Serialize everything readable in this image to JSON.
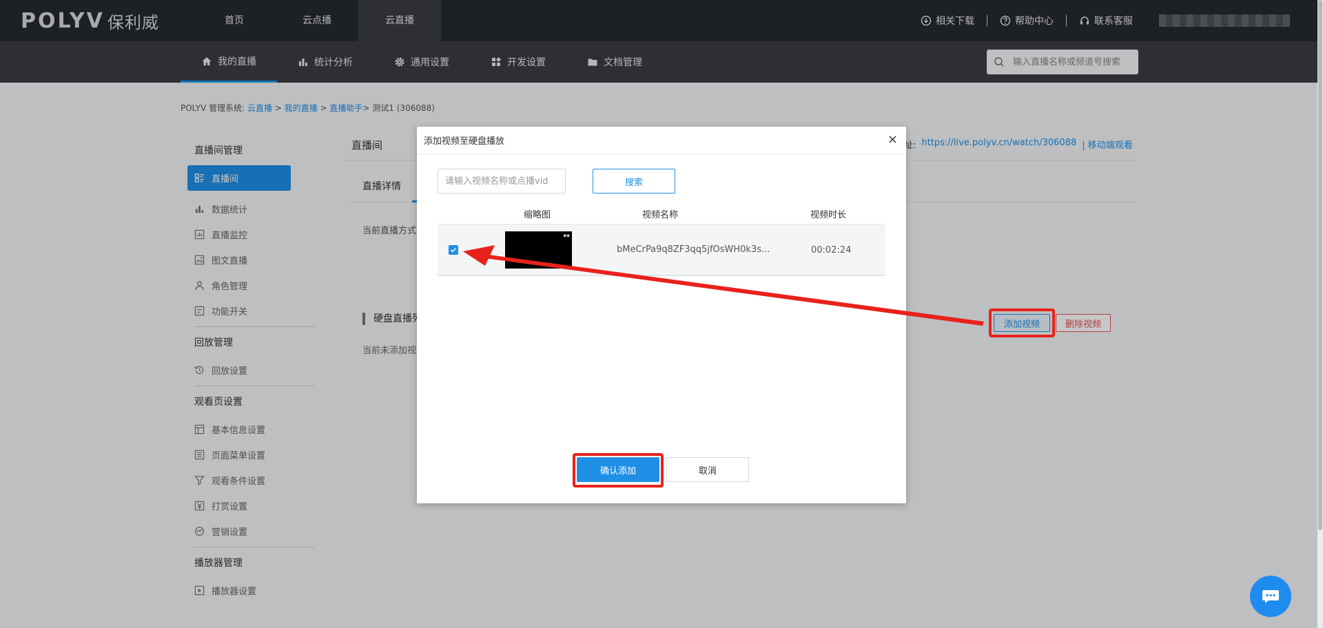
{
  "header": {
    "logo_en": "POLYV",
    "logo_cn": "保利威",
    "nav": [
      "首页",
      "云点播",
      "云直播"
    ],
    "right_links": [
      "相关下载",
      "帮助中心",
      "联系客服"
    ]
  },
  "subnav": {
    "items": [
      "我的直播",
      "统计分析",
      "通用设置",
      "开发设置",
      "文档管理"
    ],
    "search_placeholder": "输入直播名称或频道号搜索"
  },
  "breadcrumb": {
    "prefix": "POLYV 管理系统:",
    "items": [
      "云直播",
      "我的直播",
      "直播助手"
    ],
    "current": "测试1 (306088)"
  },
  "sidebar": {
    "groups": [
      {
        "title": "直播间管理",
        "items": [
          "直播间",
          "数据统计",
          "直播监控",
          "图文直播",
          "角色管理",
          "功能开关"
        ]
      },
      {
        "title": "回放管理",
        "items": [
          "回放设置"
        ]
      },
      {
        "title": "观看页设置",
        "items": [
          "基本信息设置",
          "页面菜单设置",
          "观看条件设置",
          "打赏设置",
          "营销设置"
        ]
      },
      {
        "title": "播放器管理",
        "items": [
          "播放器设置"
        ]
      }
    ]
  },
  "main": {
    "title": "直播间",
    "tab": "直播详情",
    "live_mode": "当前直播方式",
    "watch_label": "址:",
    "watch_url": "https://live.polyv.cn/watch/306088",
    "mobile_link": "移动端观看",
    "section_title": "硬盘直播列",
    "empty_tip": "当前未添加视",
    "add_video": "添加视频",
    "delete_video": "删除视频"
  },
  "dialog": {
    "title": "添加视频至硬盘播放",
    "close": "×",
    "search_placeholder": "请输入视频名称或点播vid",
    "search_button": "搜索",
    "columns": [
      "缩略图",
      "视频名称",
      "视频时长"
    ],
    "rows": [
      {
        "checked": true,
        "name": "bMeCrPa9q8ZF3qq5jfOsWH0k3s...",
        "duration": "00:02:24"
      }
    ],
    "confirm": "确认添加",
    "cancel": "取消"
  },
  "colors": {
    "accent": "#1f8fe6",
    "header_bg": "#26292f",
    "subnav_bg": "#3a3d44",
    "highlight": "#e8221b",
    "danger": "#e65050"
  }
}
